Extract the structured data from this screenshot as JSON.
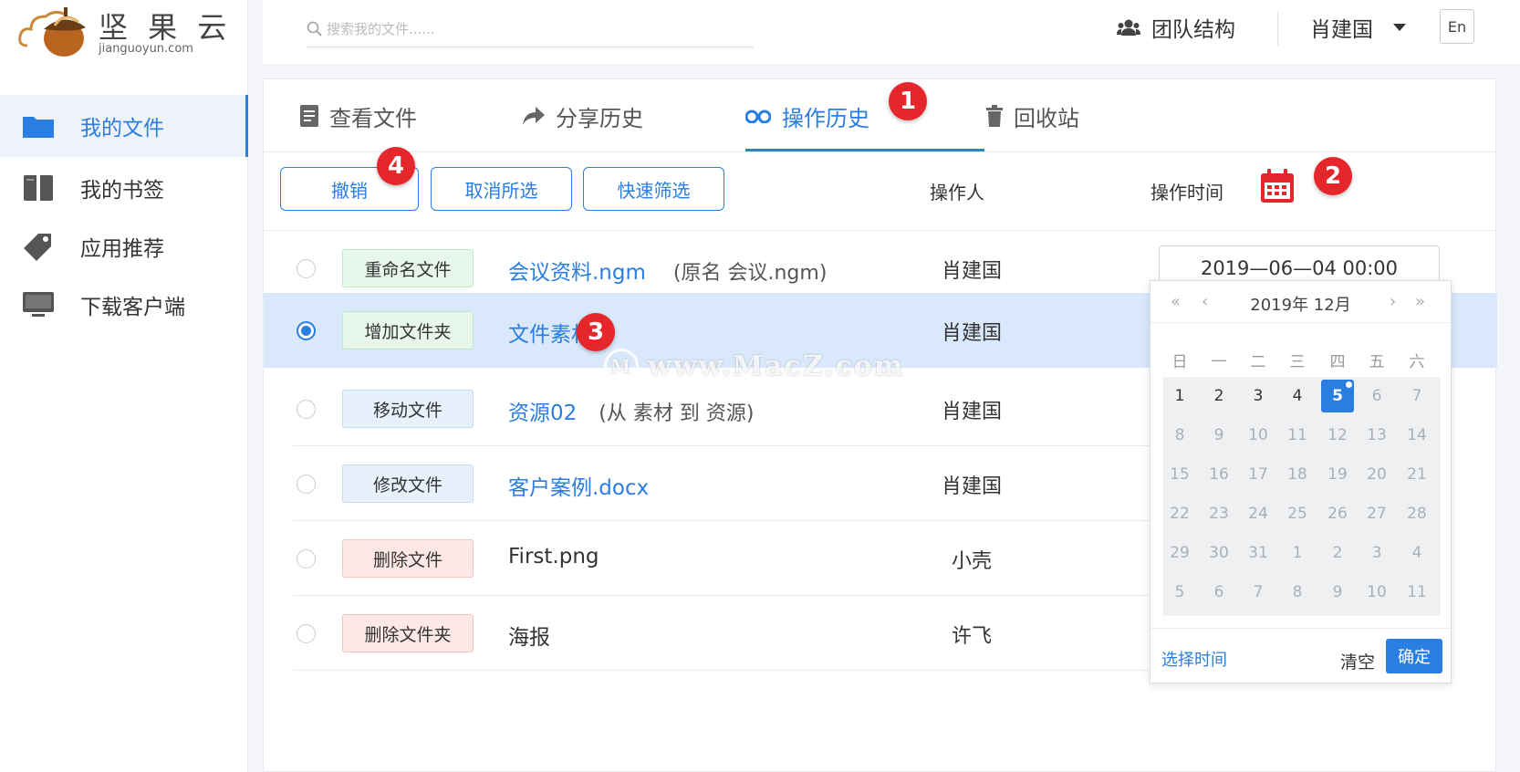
{
  "brand": {
    "name_cn": "坚 果 云",
    "name_en": "jianguoyun.com"
  },
  "sidebar": {
    "items": [
      {
        "label": "我的文件",
        "icon": "folder-icon",
        "active": true
      },
      {
        "label": "我的书签",
        "icon": "bookmark-icon"
      },
      {
        "label": "应用推荐",
        "icon": "tag-icon"
      },
      {
        "label": "下载客户端",
        "icon": "monitor-icon"
      }
    ]
  },
  "header": {
    "search_placeholder": "搜索我的文件......",
    "team_label": "团队结构",
    "user_name": "肖建国",
    "lang_label": "En"
  },
  "tabs": [
    {
      "label": "查看文件",
      "icon": "document-icon"
    },
    {
      "label": "分享历史",
      "icon": "share-arrow-icon"
    },
    {
      "label": "操作历史",
      "icon": "glasses-icon",
      "active": true
    },
    {
      "label": "回收站",
      "icon": "trash-icon"
    }
  ],
  "toolbar": {
    "undo": "撤销",
    "deselect": "取消所选",
    "quick_filter": "快速筛选",
    "operator_header": "操作人",
    "time_header": "操作时间"
  },
  "badges": [
    "1",
    "2",
    "3",
    "4"
  ],
  "rows": [
    {
      "action": "重命名文件",
      "tag_color": "green",
      "file": "会议资料.ngm",
      "note": "(原名 会议.ngm)",
      "operator": "肖建国",
      "selected": false
    },
    {
      "action": "增加文件夹",
      "tag_color": "green",
      "file": "文件素材",
      "note": "",
      "operator": "肖建国",
      "selected": true
    },
    {
      "action": "移动文件",
      "tag_color": "blue",
      "file": "资源02",
      "note": "(从 素材 到 资源)",
      "operator": "肖建国",
      "selected": false
    },
    {
      "action": "修改文件",
      "tag_color": "blue",
      "file": "客户案例.docx",
      "note": "",
      "operator": "肖建国",
      "selected": false
    },
    {
      "action": "删除文件",
      "tag_color": "red",
      "file": "First.png",
      "note": "",
      "operator": "小壳",
      "selected": false
    },
    {
      "action": "删除文件夹",
      "tag_color": "red",
      "file": "海报",
      "note": "",
      "operator": "许飞",
      "selected": false
    }
  ],
  "date_input": "2019—06—04 00:00",
  "calendar": {
    "nav_prev_year": "«",
    "nav_prev_month": "‹",
    "title": "2019年 12月",
    "nav_next_month": "›",
    "nav_next_year": "»",
    "weekdays": [
      "日",
      "一",
      "二",
      "三",
      "四",
      "五",
      "六"
    ],
    "weeks": [
      [
        "1",
        "2",
        "3",
        "4",
        "5",
        "6",
        "7"
      ],
      [
        "8",
        "9",
        "10",
        "11",
        "12",
        "13",
        "14"
      ],
      [
        "15",
        "16",
        "17",
        "18",
        "19",
        "20",
        "21"
      ],
      [
        "22",
        "23",
        "24",
        "25",
        "26",
        "27",
        "28"
      ],
      [
        "29",
        "30",
        "31",
        "1",
        "2",
        "3",
        "4"
      ],
      [
        "5",
        "6",
        "7",
        "8",
        "9",
        "10",
        "11"
      ]
    ],
    "selected_day": "5",
    "pick_time": "选择时间",
    "clear": "清空",
    "confirm": "确定"
  },
  "watermark": {
    "mark": "M",
    "text": "www.MacZ.com"
  }
}
